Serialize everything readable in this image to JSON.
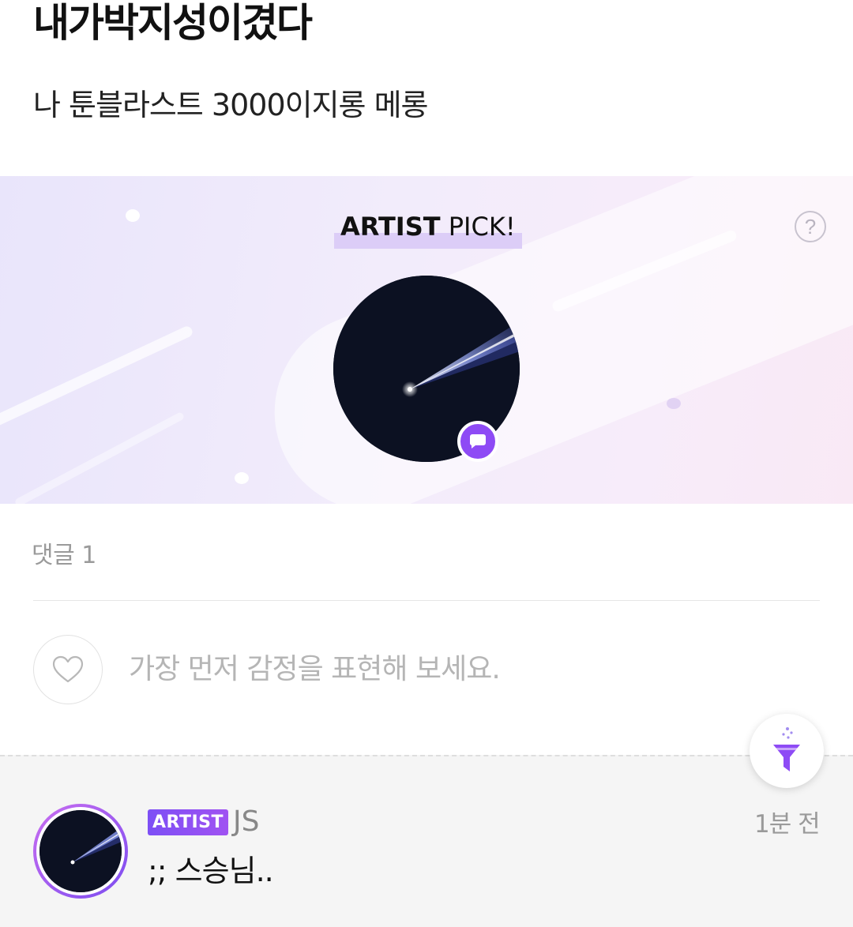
{
  "post": {
    "title": "내가박지성이겼다",
    "body": "나 툰블라스트 3000이지롱 메롱"
  },
  "artist_pick": {
    "label_strong": "ARTIST",
    "label_rest": " PICK!",
    "help": "?",
    "highlight_color": "#dccdf7"
  },
  "reactions": {
    "comment_count_label": "댓글 1",
    "prompt": "가장 먼저 감정을 표현해 보세요."
  },
  "comments": [
    {
      "badge": "ARTIST",
      "author": "JS",
      "time": "1분 전",
      "text": ";; 스승님.."
    }
  ],
  "colors": {
    "accent": "#8e4bf5",
    "badge_gradient_start": "#7d4ff5",
    "badge_gradient_end": "#a052f2"
  },
  "icons": {
    "help": "question-circle-icon",
    "chat": "speech-bubble-icon",
    "heart": "heart-outline-icon",
    "filter": "funnel-icon"
  }
}
